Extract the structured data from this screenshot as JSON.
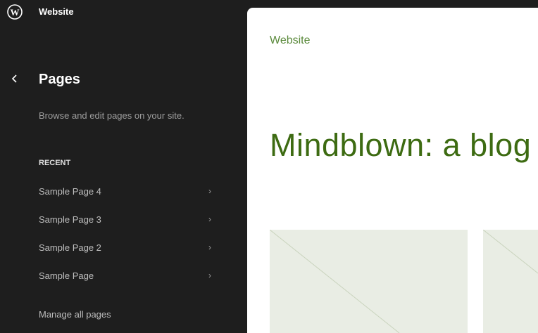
{
  "header": {
    "site_title": "Website",
    "logo_icon": "wordpress-icon"
  },
  "sidebar": {
    "title": "Pages",
    "description": "Browse and edit pages on your site.",
    "section_label": "RECENT",
    "items": [
      {
        "label": "Sample Page 4"
      },
      {
        "label": "Sample Page 3"
      },
      {
        "label": "Sample Page 2"
      },
      {
        "label": "Sample Page"
      }
    ],
    "manage_link": "Manage all pages"
  },
  "preview": {
    "site_title": "Website",
    "heading": "Mindblown: a blog",
    "accent": "#3d6b12"
  }
}
